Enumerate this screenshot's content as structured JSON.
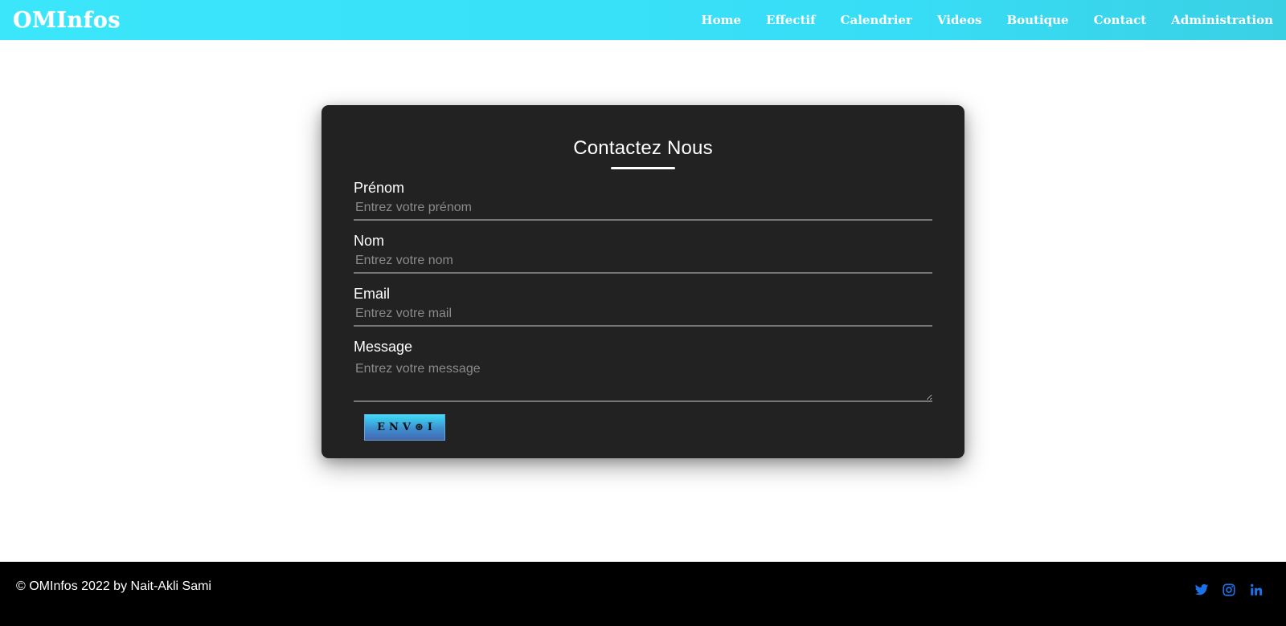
{
  "navbar": {
    "logo": "OMInfos",
    "links": [
      {
        "label": "Home"
      },
      {
        "label": "Effectif"
      },
      {
        "label": "Calendrier"
      },
      {
        "label": "Videos"
      },
      {
        "label": "Boutique"
      },
      {
        "label": "Contact"
      },
      {
        "label": "Administration"
      }
    ]
  },
  "form": {
    "title": "Contactez Nous",
    "fields": [
      {
        "label": "Prénom",
        "placeholder": "Entrez votre prénom",
        "value": ""
      },
      {
        "label": "Nom",
        "placeholder": "Entrez votre nom",
        "value": ""
      },
      {
        "label": "Email",
        "placeholder": "Entrez votre mail",
        "value": ""
      },
      {
        "label": "Message",
        "placeholder": "Entrez votre message",
        "value": ""
      }
    ],
    "submit_label": "ENV⊛I"
  },
  "footer": {
    "copyright": "© OMInfos 2022 by Nait-Akli Sami",
    "social": [
      {
        "icon": "twitter-icon"
      },
      {
        "icon": "instagram-icon"
      },
      {
        "icon": "linkedin-icon"
      }
    ]
  },
  "colors": {
    "navbar_accent": "#38e0f8",
    "card_background": "#222222",
    "footer_background": "#000000",
    "social_icon": "#1a73e8"
  }
}
